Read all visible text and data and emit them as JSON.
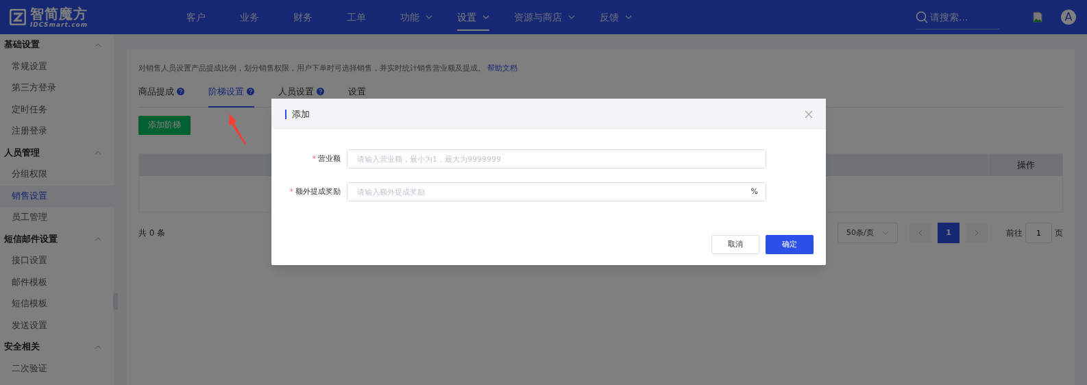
{
  "header": {
    "logo": {
      "name": "智简魔方",
      "sub": "IDCSmart.com"
    },
    "nav": [
      {
        "label": "客户",
        "dropdown": false,
        "selected": false
      },
      {
        "label": "业务",
        "dropdown": false,
        "selected": false
      },
      {
        "label": "财务",
        "dropdown": false,
        "selected": false
      },
      {
        "label": "工单",
        "dropdown": false,
        "selected": false
      },
      {
        "label": "功能",
        "dropdown": true,
        "selected": false
      },
      {
        "label": "设置",
        "dropdown": true,
        "selected": true
      },
      {
        "label": "资源与商店",
        "dropdown": true,
        "selected": false
      },
      {
        "label": "反馈",
        "dropdown": true,
        "selected": false
      }
    ],
    "search": {
      "placeholder": "请搜索..."
    },
    "avatar": "A"
  },
  "sidebar": {
    "groups": [
      {
        "title": "基础设置",
        "expanded": true,
        "items": [
          {
            "label": "常规设置",
            "selected": false
          },
          {
            "label": "第三方登录",
            "selected": false
          },
          {
            "label": "定时任务",
            "selected": false
          },
          {
            "label": "注册登录",
            "selected": false
          }
        ]
      },
      {
        "title": "人员管理",
        "expanded": true,
        "items": [
          {
            "label": "分组权限",
            "selected": false
          },
          {
            "label": "销售设置",
            "selected": true
          },
          {
            "label": "员工管理",
            "selected": false
          }
        ]
      },
      {
        "title": "短信邮件设置",
        "expanded": true,
        "items": [
          {
            "label": "接口设置",
            "selected": false
          },
          {
            "label": "邮件模板",
            "selected": false
          },
          {
            "label": "短信模板",
            "selected": false
          },
          {
            "label": "发送设置",
            "selected": false
          }
        ]
      },
      {
        "title": "安全相关",
        "expanded": true,
        "items": [
          {
            "label": "二次验证",
            "selected": false
          }
        ]
      }
    ]
  },
  "main": {
    "description": "对销售人员设置产品提成比例，划分销售权限，用户下单时可选择销售，并实时统计销售营业额及提成。",
    "help_link": "帮助文档",
    "tabs": [
      {
        "label": "商品提成",
        "help": true,
        "selected": false
      },
      {
        "label": "阶梯设置",
        "help": true,
        "selected": true
      },
      {
        "label": "人员设置",
        "help": true,
        "selected": false
      },
      {
        "label": "设置",
        "help": false,
        "selected": false
      }
    ],
    "add_button": "添加阶梯",
    "table": {
      "columns": [
        {
          "label": "操作"
        }
      ]
    },
    "total": "共 0 条",
    "pagination": {
      "page_size": "50条/页",
      "pages": [
        {
          "label": "1",
          "selected": true
        }
      ],
      "goto_label": "前往",
      "goto_value": "1",
      "page_suffix": "页"
    }
  },
  "dialog": {
    "title": "添加",
    "fields": [
      {
        "label": "营业额",
        "required_mark": "*",
        "placeholder": "请输入营业额，最小为1，最大为9999999"
      },
      {
        "label": "额外提成奖励",
        "required_mark": "*",
        "placeholder": "请输入额外提成奖励",
        "suffix": "%"
      }
    ],
    "buttons": [
      {
        "label": "取消",
        "kind": "secondary"
      },
      {
        "label": "确定",
        "kind": "primary"
      }
    ]
  }
}
